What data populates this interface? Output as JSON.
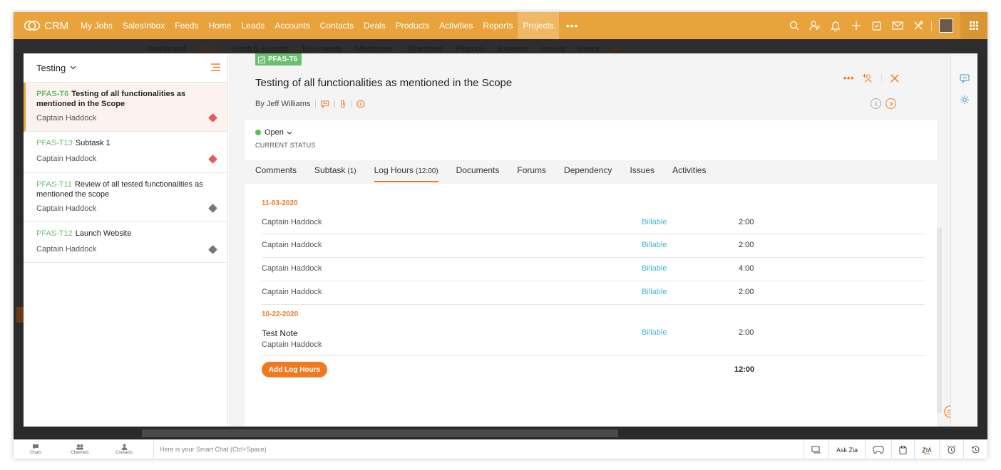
{
  "nav": {
    "logo": "CRM",
    "links": [
      "My Jobs",
      "SalesInbox",
      "Feeds",
      "Home",
      "Leads",
      "Accounts",
      "Contacts",
      "Deals",
      "Products",
      "Activities",
      "Reports",
      "Projects"
    ],
    "active": "Projects",
    "more": "•••"
  },
  "subnav": {
    "tabs": [
      "Dashboard",
      "Tasks",
      "Gantt & Reports",
      "Documents",
      "Milestones",
      "Timesheet",
      "Finance",
      "Expense",
      "Issues",
      "Users",
      "•••"
    ]
  },
  "list": {
    "header": "Testing",
    "items": [
      {
        "id": "PFAS-T6",
        "title": "Testing of all functionalities as mentioned in the Scope",
        "owner": "Captain Haddock",
        "priority": "red"
      },
      {
        "id": "PFAS-T13",
        "title": "Subtask 1",
        "owner": "Captain Haddock",
        "priority": "red"
      },
      {
        "id": "PFAS-T11",
        "title": "Review of all tested functionalities as mentioned the scope",
        "owner": "Captain Haddock",
        "priority": "grey"
      },
      {
        "id": "PFAS-T12",
        "title": "Launch Website",
        "owner": "Captain Haddock",
        "priority": "grey"
      }
    ]
  },
  "task": {
    "id": "PFAS-T6",
    "title": "Testing of all functionalities as mentioned in the Scope",
    "byline": "By Jeff Williams",
    "more": "•••"
  },
  "status": {
    "value": "Open",
    "label": "CURRENT STATUS"
  },
  "tabs": [
    {
      "label": "Comments",
      "count": ""
    },
    {
      "label": "Subtask",
      "count": "(1)"
    },
    {
      "label": "Log Hours",
      "count": "(12:00)"
    },
    {
      "label": "Documents",
      "count": ""
    },
    {
      "label": "Forums",
      "count": ""
    },
    {
      "label": "Dependency",
      "count": ""
    },
    {
      "label": "Issues",
      "count": ""
    },
    {
      "label": "Activities",
      "count": ""
    }
  ],
  "logs": {
    "groups": [
      {
        "date": "11-03-2020",
        "entries": [
          {
            "user": "Captain Haddock",
            "billing": "Billable",
            "hours": "2:00"
          },
          {
            "user": "Captain Haddock",
            "billing": "Billable",
            "hours": "2:00"
          },
          {
            "user": "Captain Haddock",
            "billing": "Billable",
            "hours": "4:00"
          },
          {
            "user": "Captain Haddock",
            "billing": "Billable",
            "hours": "2:00"
          }
        ]
      },
      {
        "date": "10-22-2020",
        "entries": [
          {
            "note": "Test Note",
            "user": "Captain Haddock",
            "billing": "Billable",
            "hours": "2:00"
          }
        ]
      }
    ],
    "add_label": "Add Log Hours",
    "total": "12:00"
  },
  "bottom": {
    "chats": "Chats",
    "channels": "Channels",
    "contacts": "Contacts",
    "smartchat_placeholder": "Here is your Smart Chat (Ctrl+Space)",
    "ask_zia": "Ask Zia"
  },
  "colors": {
    "nav": "#e9a33c",
    "accent": "#f07a22",
    "task_id": "#6cbf6c",
    "billable": "#3fb5d8"
  }
}
